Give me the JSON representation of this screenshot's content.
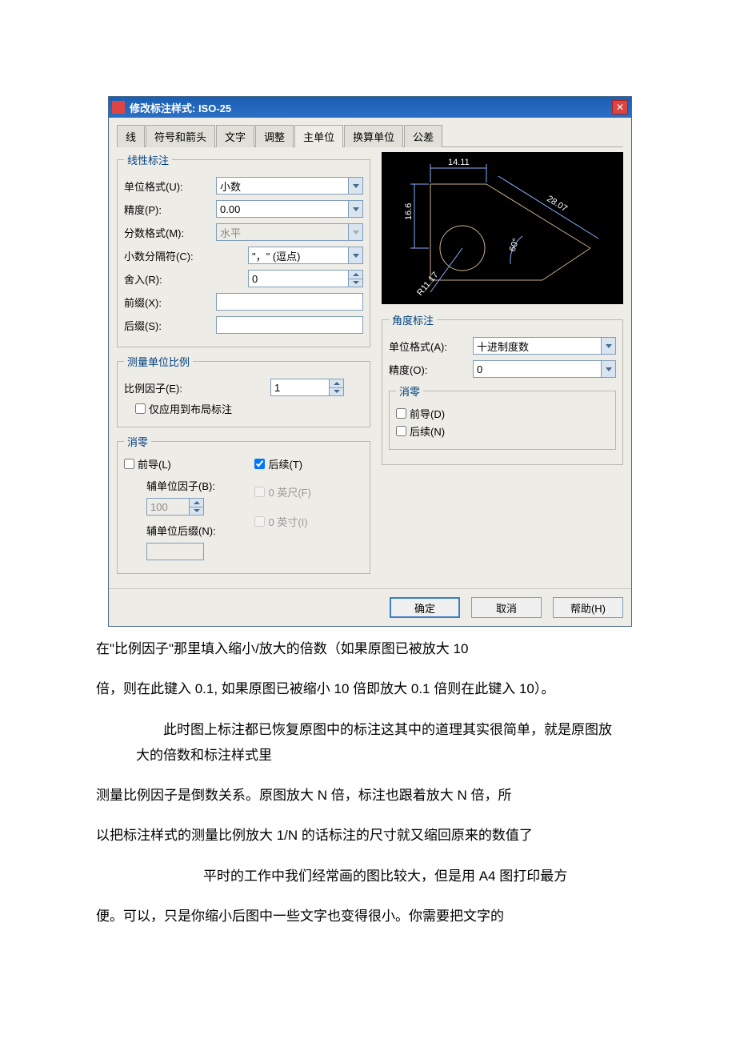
{
  "dialog": {
    "title": "修改标注样式: ISO-25",
    "close": "✕"
  },
  "tabs": [
    "线",
    "符号和箭头",
    "文字",
    "调整",
    "主单位",
    "换算单位",
    "公差"
  ],
  "linear": {
    "legend": "线性标注",
    "unit_format_label": "单位格式(U):",
    "unit_format_value": "小数",
    "precision_label": "精度(P):",
    "precision_value": "0.00",
    "fraction_label": "分数格式(M):",
    "fraction_value": "水平",
    "decimal_sep_label": "小数分隔符(C):",
    "decimal_sep_value": "\"，\"    (逗点)",
    "round_label": "舍入(R):",
    "round_value": "0",
    "prefix_label": "前缀(X):",
    "prefix_value": "",
    "suffix_label": "后缀(S):",
    "suffix_value": ""
  },
  "scale": {
    "legend": "测量单位比例",
    "factor_label": "比例因子(E):",
    "factor_value": "1",
    "layout_only": "仅应用到布局标注"
  },
  "zero_sup": {
    "legend": "消零",
    "leading": "前导(L)",
    "trailing": "后续(T)",
    "sub_factor_label": "辅单位因子(B):",
    "sub_factor_value": "100",
    "zero_feet": "0 英尺(F)",
    "sub_suffix_label": "辅单位后缀(N):",
    "sub_suffix_value": "",
    "zero_inch": "0 英寸(I)"
  },
  "preview": {
    "dim_top": "14.11",
    "dim_left": "16.6",
    "dim_diag": "28.07",
    "dim_angle": "60°",
    "dim_rad": "R11.17"
  },
  "angular": {
    "legend": "角度标注",
    "unit_format_label": "单位格式(A):",
    "unit_format_value": "十进制度数",
    "precision_label": "精度(O):",
    "precision_value": "0",
    "zero_legend": "消零",
    "leading": "前导(D)",
    "trailing": "后续(N)"
  },
  "buttons": {
    "ok": "确定",
    "cancel": "取消",
    "help": "帮助(H)"
  },
  "article": {
    "p1": "在\"比例因子\"那里填入缩小/放大的倍数（如果原图已被放大 10",
    "p2": "倍，则在此键入 0.1, 如果原图已被缩小 10 倍即放大 0.1 倍则在此键入 10）。",
    "p3": "此时图上标注都已恢复原图中的标注这其中的道理其实很简单，就是原图放大的倍数和标注样式里",
    "p4": "测量比例因子是倒数关系。原图放大 N 倍，标注也跟着放大 N 倍，所",
    "p5": "以把标注样式的测量比例放大 1/N 的话标注的尺寸就又缩回原来的数值了",
    "p6": "平时的工作中我们经常画的图比较大，但是用 A4 图打印最方",
    "p7": "便。可以，只是你缩小后图中一些文字也变得很小。你需要把文字的"
  }
}
